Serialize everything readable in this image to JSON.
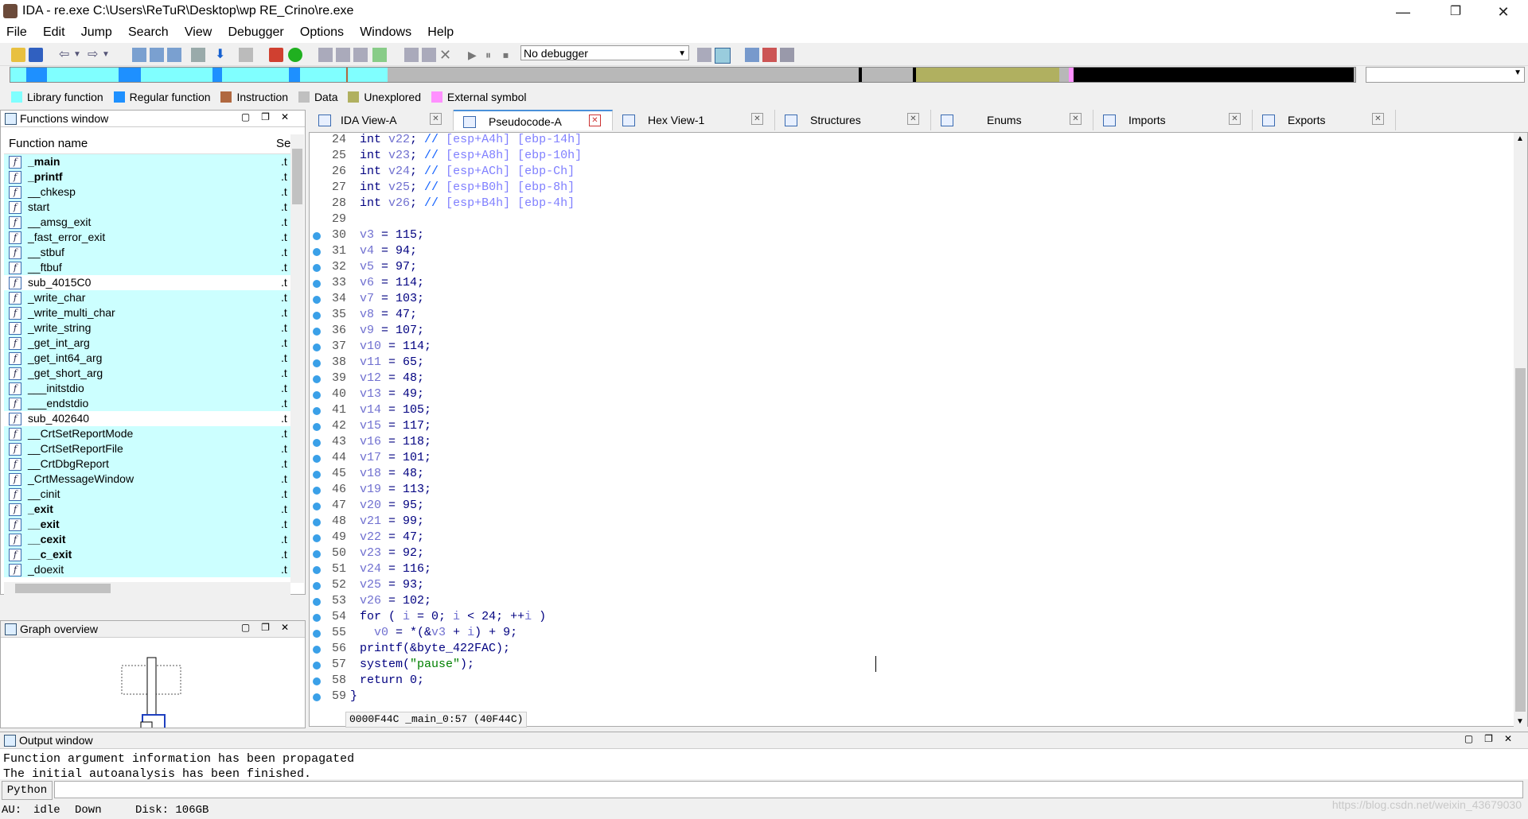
{
  "window": {
    "title": "IDA - re.exe C:\\Users\\ReTuR\\Desktop\\wp RE_Crino\\re.exe",
    "minimize": "—",
    "maximize": "❐",
    "close": "✕"
  },
  "menu": [
    "File",
    "Edit",
    "Jump",
    "Search",
    "View",
    "Debugger",
    "Options",
    "Windows",
    "Help"
  ],
  "toolbar": {
    "debugger_select": "No debugger"
  },
  "legend": [
    {
      "label": "Library function",
      "color": "#80ffff"
    },
    {
      "label": "Regular function",
      "color": "#1e90ff"
    },
    {
      "label": "Instruction",
      "color": "#b06840"
    },
    {
      "label": "Data",
      "color": "#c0c0c0"
    },
    {
      "label": "Unexplored",
      "color": "#b0b060"
    },
    {
      "label": "External symbol",
      "color": "#ff90ff"
    }
  ],
  "functions_window": {
    "title": "Functions window",
    "col_name": "Function name",
    "col_seg": "Se",
    "rows": [
      {
        "name": "_main",
        "seg": ".t",
        "bold": true,
        "hl": true
      },
      {
        "name": "_printf",
        "seg": ".t",
        "bold": true,
        "hl": true
      },
      {
        "name": "__chkesp",
        "seg": ".t",
        "bold": false,
        "hl": true
      },
      {
        "name": "start",
        "seg": ".t",
        "bold": false,
        "hl": true
      },
      {
        "name": "__amsg_exit",
        "seg": ".t",
        "bold": false,
        "hl": true
      },
      {
        "name": "_fast_error_exit",
        "seg": ".t",
        "bold": false,
        "hl": true
      },
      {
        "name": "__stbuf",
        "seg": ".t",
        "bold": false,
        "hl": true
      },
      {
        "name": "__ftbuf",
        "seg": ".t",
        "bold": false,
        "hl": true
      },
      {
        "name": "sub_4015C0",
        "seg": ".t",
        "bold": false,
        "hl": false
      },
      {
        "name": "_write_char",
        "seg": ".t",
        "bold": false,
        "hl": true
      },
      {
        "name": "_write_multi_char",
        "seg": ".t",
        "bold": false,
        "hl": true
      },
      {
        "name": "_write_string",
        "seg": ".t",
        "bold": false,
        "hl": true
      },
      {
        "name": "_get_int_arg",
        "seg": ".t",
        "bold": false,
        "hl": true
      },
      {
        "name": "_get_int64_arg",
        "seg": ".t",
        "bold": false,
        "hl": true
      },
      {
        "name": "_get_short_arg",
        "seg": ".t",
        "bold": false,
        "hl": true
      },
      {
        "name": "___initstdio",
        "seg": ".t",
        "bold": false,
        "hl": true
      },
      {
        "name": "___endstdio",
        "seg": ".t",
        "bold": false,
        "hl": true
      },
      {
        "name": "sub_402640",
        "seg": ".t",
        "bold": false,
        "hl": false
      },
      {
        "name": "__CrtSetReportMode",
        "seg": ".t",
        "bold": false,
        "hl": true
      },
      {
        "name": "__CrtSetReportFile",
        "seg": ".t",
        "bold": false,
        "hl": true
      },
      {
        "name": "__CrtDbgReport",
        "seg": ".t",
        "bold": false,
        "hl": true
      },
      {
        "name": "_CrtMessageWindow",
        "seg": ".t",
        "bold": false,
        "hl": true
      },
      {
        "name": "__cinit",
        "seg": ".t",
        "bold": false,
        "hl": true
      },
      {
        "name": "_exit",
        "seg": ".t",
        "bold": true,
        "hl": true
      },
      {
        "name": "__exit",
        "seg": ".t",
        "bold": true,
        "hl": true
      },
      {
        "name": "__cexit",
        "seg": ".t",
        "bold": true,
        "hl": true
      },
      {
        "name": "__c_exit",
        "seg": ".t",
        "bold": true,
        "hl": true
      },
      {
        "name": "_doexit",
        "seg": ".t",
        "bold": false,
        "hl": true
      }
    ]
  },
  "graph_overview": {
    "title": "Graph overview"
  },
  "tabs": [
    {
      "label": "IDA View-A",
      "active": false,
      "icon": "ida-view-icon"
    },
    {
      "label": "Pseudocode-A",
      "active": true,
      "icon": "pseudocode-icon"
    },
    {
      "label": "Hex View-1",
      "active": false,
      "icon": "hex-view-icon"
    },
    {
      "label": "Structures",
      "active": false,
      "icon": "structures-icon"
    },
    {
      "label": "Enums",
      "active": false,
      "icon": "enums-icon"
    },
    {
      "label": "Imports",
      "active": false,
      "icon": "imports-icon"
    },
    {
      "label": "Exports",
      "active": false,
      "icon": "exports-icon"
    }
  ],
  "pseudocode": {
    "lines": [
      {
        "n": "24",
        "dot": false,
        "kind": "decl",
        "var": "v22",
        "c1": "[esp+A4h]",
        "c2": "[ebp-14h]"
      },
      {
        "n": "25",
        "dot": false,
        "kind": "decl",
        "var": "v23",
        "c1": "[esp+A8h]",
        "c2": "[ebp-10h]"
      },
      {
        "n": "26",
        "dot": false,
        "kind": "decl",
        "var": "v24",
        "c1": "[esp+ACh]",
        "c2": "[ebp-Ch]"
      },
      {
        "n": "27",
        "dot": false,
        "kind": "decl",
        "var": "v25",
        "c1": "[esp+B0h]",
        "c2": "[ebp-8h]"
      },
      {
        "n": "28",
        "dot": false,
        "kind": "decl",
        "var": "v26",
        "c1": "[esp+B4h]",
        "c2": "[ebp-4h]"
      },
      {
        "n": "29",
        "dot": false,
        "kind": "blank"
      },
      {
        "n": "30",
        "dot": true,
        "kind": "assign",
        "var": "v3",
        "val": "115"
      },
      {
        "n": "31",
        "dot": true,
        "kind": "assign",
        "var": "v4",
        "val": "94"
      },
      {
        "n": "32",
        "dot": true,
        "kind": "assign",
        "var": "v5",
        "val": "97"
      },
      {
        "n": "33",
        "dot": true,
        "kind": "assign",
        "var": "v6",
        "val": "114"
      },
      {
        "n": "34",
        "dot": true,
        "kind": "assign",
        "var": "v7",
        "val": "103"
      },
      {
        "n": "35",
        "dot": true,
        "kind": "assign",
        "var": "v8",
        "val": "47"
      },
      {
        "n": "36",
        "dot": true,
        "kind": "assign",
        "var": "v9",
        "val": "107"
      },
      {
        "n": "37",
        "dot": true,
        "kind": "assign",
        "var": "v10",
        "val": "114"
      },
      {
        "n": "38",
        "dot": true,
        "kind": "assign",
        "var": "v11",
        "val": "65"
      },
      {
        "n": "39",
        "dot": true,
        "kind": "assign",
        "var": "v12",
        "val": "48"
      },
      {
        "n": "40",
        "dot": true,
        "kind": "assign",
        "var": "v13",
        "val": "49"
      },
      {
        "n": "41",
        "dot": true,
        "kind": "assign",
        "var": "v14",
        "val": "105"
      },
      {
        "n": "42",
        "dot": true,
        "kind": "assign",
        "var": "v15",
        "val": "117"
      },
      {
        "n": "43",
        "dot": true,
        "kind": "assign",
        "var": "v16",
        "val": "118"
      },
      {
        "n": "44",
        "dot": true,
        "kind": "assign",
        "var": "v17",
        "val": "101"
      },
      {
        "n": "45",
        "dot": true,
        "kind": "assign",
        "var": "v18",
        "val": "48"
      },
      {
        "n": "46",
        "dot": true,
        "kind": "assign",
        "var": "v19",
        "val": "113"
      },
      {
        "n": "47",
        "dot": true,
        "kind": "assign",
        "var": "v20",
        "val": "95"
      },
      {
        "n": "48",
        "dot": true,
        "kind": "assign",
        "var": "v21",
        "val": "99"
      },
      {
        "n": "49",
        "dot": true,
        "kind": "assign",
        "var": "v22",
        "val": "47"
      },
      {
        "n": "50",
        "dot": true,
        "kind": "assign",
        "var": "v23",
        "val": "92"
      },
      {
        "n": "51",
        "dot": true,
        "kind": "assign",
        "var": "v24",
        "val": "116"
      },
      {
        "n": "52",
        "dot": true,
        "kind": "assign",
        "var": "v25",
        "val": "93"
      },
      {
        "n": "53",
        "dot": true,
        "kind": "assign",
        "var": "v26",
        "val": "102"
      },
      {
        "n": "54",
        "dot": true,
        "kind": "for"
      },
      {
        "n": "55",
        "dot": true,
        "kind": "body"
      },
      {
        "n": "56",
        "dot": true,
        "kind": "printf"
      },
      {
        "n": "57",
        "dot": true,
        "kind": "system"
      },
      {
        "n": "58",
        "dot": true,
        "kind": "return"
      },
      {
        "n": "59",
        "dot": true,
        "kind": "close"
      }
    ],
    "status": "0000F44C _main_0:57 (40F44C)"
  },
  "output_window": {
    "title": "Output window",
    "lines": [
      "Function argument information has been propagated",
      "The initial autoanalysis has been finished."
    ]
  },
  "python_label": "Python",
  "status": {
    "au": "AU:",
    "state": "idle",
    "dir": "Down",
    "disk": "Disk: 106GB"
  },
  "watermark": "https://blog.csdn.net/weixin_43679030"
}
